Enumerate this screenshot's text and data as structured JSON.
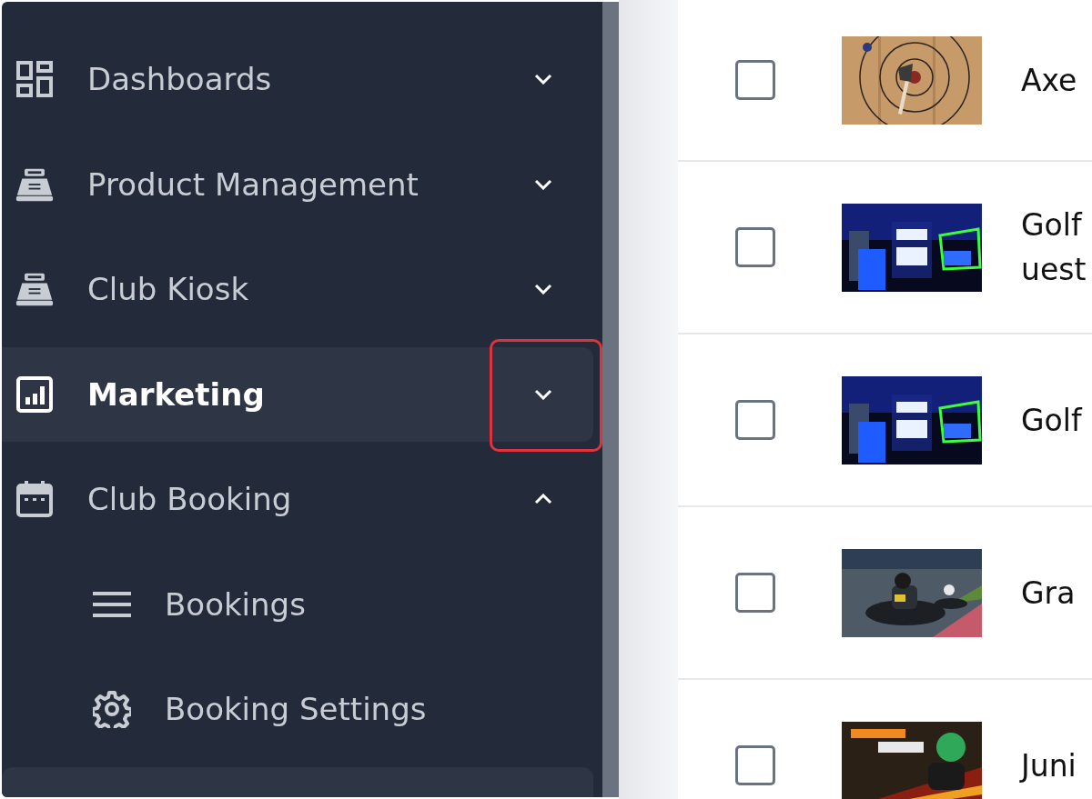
{
  "sidebar": {
    "items": [
      {
        "kind": "item",
        "label": "Dashboards",
        "expanded": false,
        "highlighted": false,
        "annotated": false
      },
      {
        "kind": "item",
        "label": "Product Management",
        "expanded": false,
        "highlighted": false,
        "annotated": false
      },
      {
        "kind": "item",
        "label": "Club Kiosk",
        "expanded": false,
        "highlighted": false,
        "annotated": false
      },
      {
        "kind": "item",
        "label": "Marketing",
        "expanded": false,
        "highlighted": true,
        "annotated": true
      },
      {
        "kind": "item",
        "label": "Club Booking",
        "expanded": true,
        "highlighted": false,
        "annotated": false,
        "children": [
          {
            "label": "Bookings"
          },
          {
            "label": "Booking Settings"
          }
        ]
      },
      {
        "kind": "cut_off",
        "highlighted": true
      }
    ]
  },
  "table": {
    "rows": [
      {
        "checked": false,
        "kind": "picture",
        "lines": [
          "Axe"
        ]
      },
      {
        "checked": false,
        "kind": "picture",
        "lines": [
          "Golf",
          "uest"
        ]
      },
      {
        "checked": false,
        "kind": "picture",
        "lines": [
          "Golf"
        ]
      },
      {
        "checked": false,
        "kind": "picture",
        "lines": [
          "Gra"
        ]
      },
      {
        "checked": false,
        "kind": "picture",
        "lines": [
          "Juni"
        ]
      }
    ]
  }
}
